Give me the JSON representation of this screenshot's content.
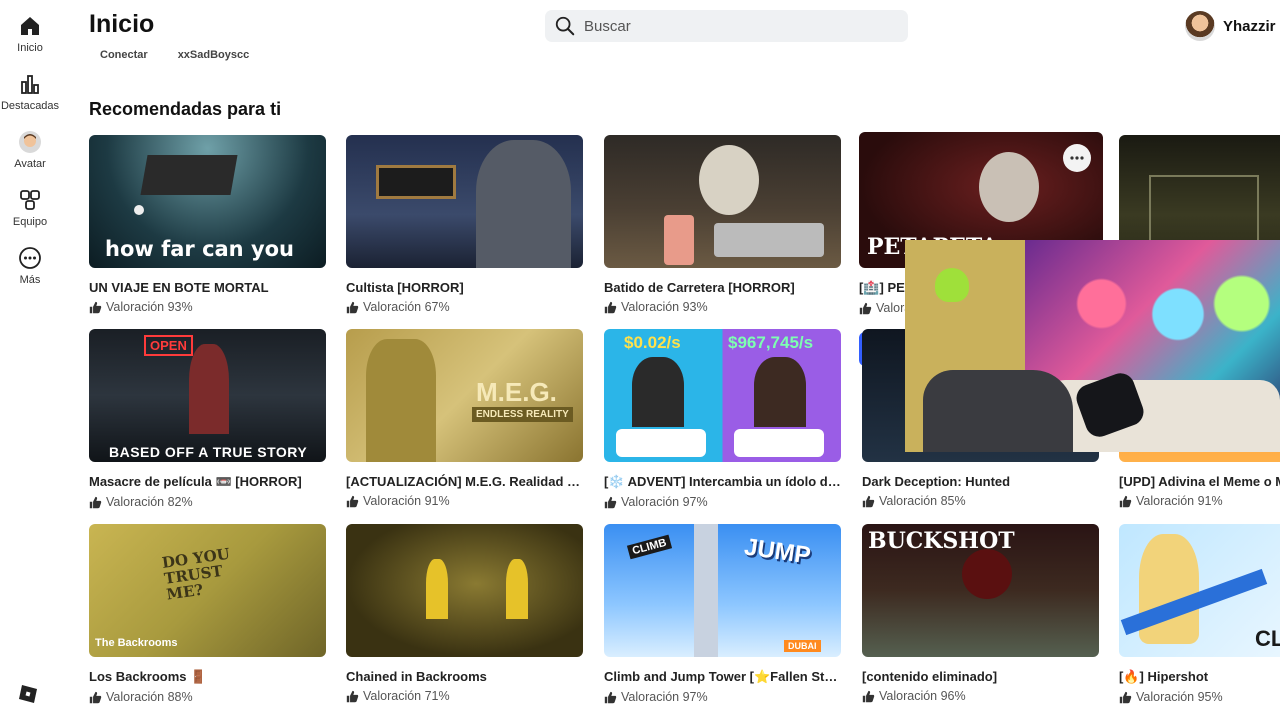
{
  "sidebar": {
    "items": [
      {
        "label": "Inicio",
        "icon": "home-icon"
      },
      {
        "label": "Destacadas",
        "icon": "charts-icon"
      },
      {
        "label": "Avatar",
        "icon": "avatar-icon"
      },
      {
        "label": "Equipo",
        "icon": "team-icon"
      },
      {
        "label": "Más",
        "icon": "more-icon"
      }
    ]
  },
  "header": {
    "title": "Inicio",
    "sub_tabs": [
      "Conectar",
      "xxSadBoyscc"
    ],
    "search_placeholder": "Buscar",
    "username": "Yhazzir"
  },
  "section": {
    "title": "Recomendadas para ti"
  },
  "cards": [
    {
      "name": "UN VIAJE EN BOTE MORTAL",
      "rating": "Valoración 93%",
      "caption": "how far can you go"
    },
    {
      "name": "Cultista [HORROR]",
      "rating": "Valoración 67%"
    },
    {
      "name": "Batido de Carretera [HORROR]",
      "rating": "Valoración 93%"
    },
    {
      "name": "[🏥] PET",
      "rating": "Valora",
      "caption": "PETAPETA:"
    },
    {
      "name": "Masacre de película 📼 [HORROR]",
      "rating": "Valoración 82%",
      "caption": "BASED OFF A TRUE STORY",
      "badge": "OPEN"
    },
    {
      "name": "[ACTUALIZACIÓN] M.E.G. Realidad In...",
      "rating": "Valoración 91%",
      "caption": "M.E.G.",
      "caption2": "ENDLESS REALITY"
    },
    {
      "name": "[❄️ ADVENT] Intercambia un ídolo de ...",
      "rating": "Valoración 97%",
      "caption": "$0.02/s",
      "caption2": "$967,745/s"
    },
    {
      "name": "Dark Deception: Hunted",
      "rating": "Valoración 85%"
    },
    {
      "name": "[UPD] Adivina el Meme o M",
      "rating": "Valoración 91%"
    },
    {
      "name": "Los Backrooms 🚪",
      "rating": "Valoración 88%",
      "caption": "The Backrooms",
      "caption2": "DO YOU TRUST ME?"
    },
    {
      "name": "Chained in Backrooms",
      "rating": "Valoración 71%"
    },
    {
      "name": "Climb and Jump Tower [⭐Fallen Star...",
      "rating": "Valoración 97%",
      "caption": "JUMP",
      "caption2": "CLIMB",
      "caption3": "DUBAI"
    },
    {
      "name": "[contenido eliminado]",
      "rating": "Valoración 96%",
      "caption": "BUCKSHOT"
    },
    {
      "name": "[🔥] Hipershot",
      "rating": "Valoración 95%",
      "caption": "CL"
    }
  ],
  "colors": {
    "accent": "#335fff",
    "search_bg": "#eff1f3"
  }
}
